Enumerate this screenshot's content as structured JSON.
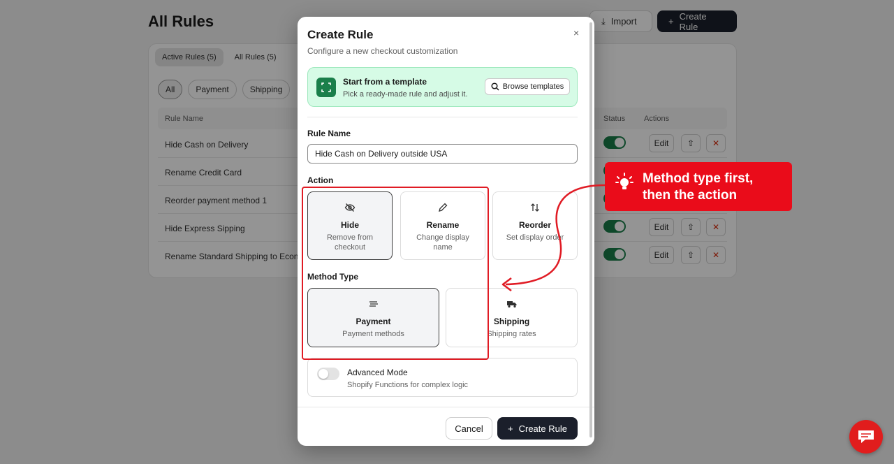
{
  "background": {
    "title": "All Rules",
    "import_label": "Import",
    "create_rule_label": "Create Rule",
    "segments": [
      "Active Rules (5)",
      "All Rules (5)"
    ],
    "filters": [
      "All",
      "Payment",
      "Shipping"
    ],
    "columns": {
      "name": "Rule Name",
      "status": "Status",
      "actions": "Actions"
    },
    "rows": [
      {
        "name": "Hide Cash on Delivery",
        "edit": "Edit"
      },
      {
        "name": "Rename Credit Card",
        "edit": "Edit"
      },
      {
        "name": "Reorder payment method 1",
        "edit": "Edit"
      },
      {
        "name": "Hide Express Sipping",
        "edit": "Edit"
      },
      {
        "name": "Rename Standard Shipping to Econo",
        "edit": "Edit"
      }
    ]
  },
  "modal": {
    "title": "Create Rule",
    "subtitle": "Configure a new checkout customization",
    "close": "×",
    "template": {
      "title": "Start from a template",
      "subtitle": "Pick a ready-made rule and adjust it.",
      "button": "Browse templates"
    },
    "rule_name": {
      "label": "Rule Name",
      "value": "Hide Cash on Delivery outside USA"
    },
    "action": {
      "label": "Action",
      "options": [
        {
          "title": "Hide",
          "desc": "Remove from checkout",
          "icon": "eye-off-icon",
          "selected": true
        },
        {
          "title": "Rename",
          "desc": "Change display name",
          "icon": "pencil-icon",
          "selected": false
        },
        {
          "title": "Reorder",
          "desc": "Set display order",
          "icon": "sort-arrows-icon",
          "selected": false
        }
      ]
    },
    "method_type": {
      "label": "Method Type",
      "options": [
        {
          "title": "Payment",
          "desc": "Payment methods",
          "icon": "card-icon",
          "selected": true
        },
        {
          "title": "Shipping",
          "desc": "Shipping rates",
          "icon": "truck-icon",
          "selected": false
        }
      ]
    },
    "advanced": {
      "title": "Advanced Mode",
      "subtitle": "Shopify Functions for complex logic",
      "enabled": false
    },
    "cancel_label": "Cancel",
    "create_label": "Create Rule"
  },
  "annotation": {
    "line1": "Method type first,",
    "line2": "then the action",
    "color": "#ea0c1a"
  }
}
